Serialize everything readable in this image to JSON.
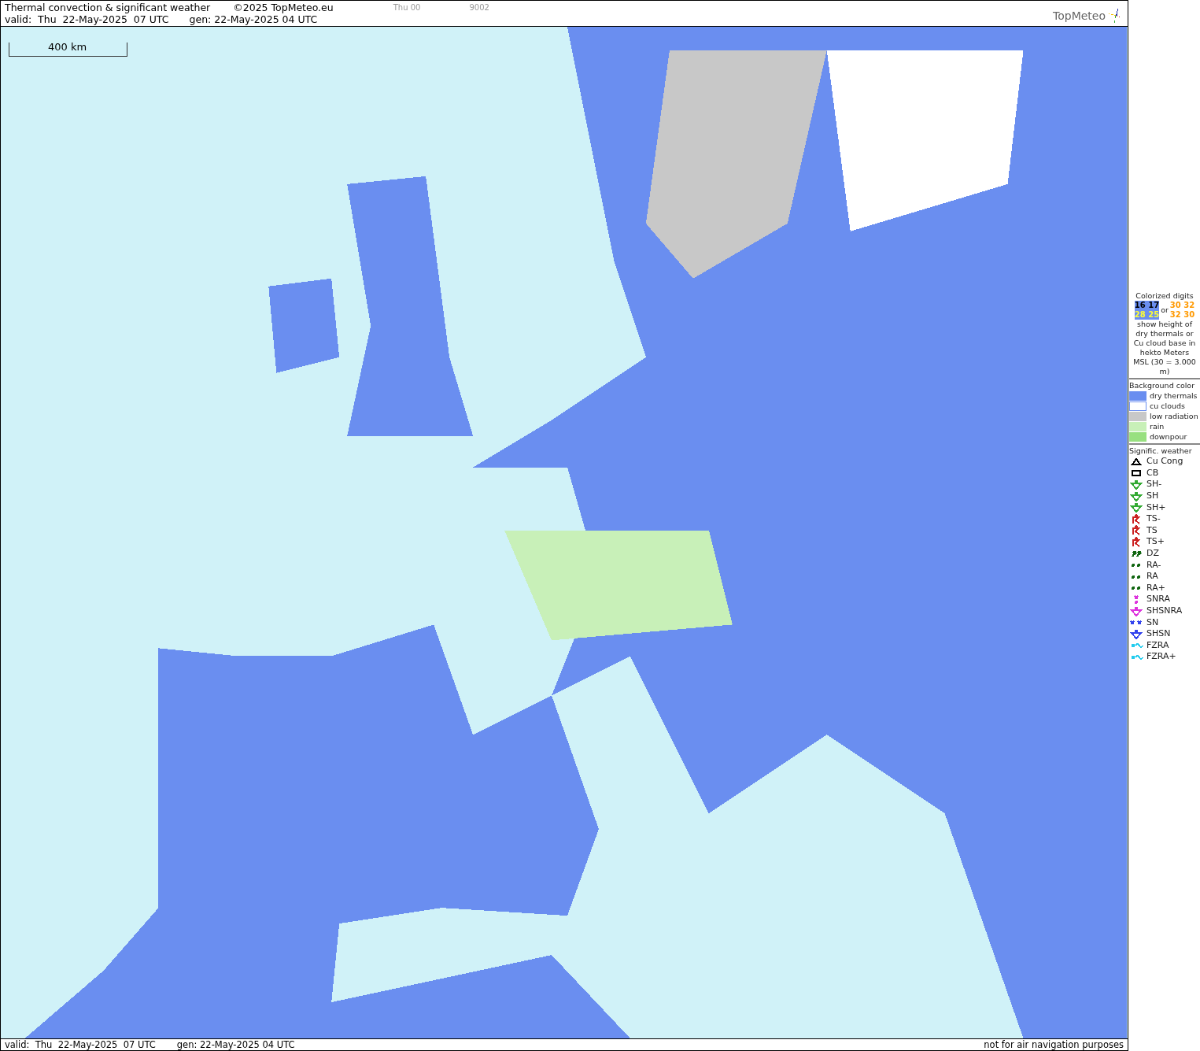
{
  "header": {
    "title": "Thermal convection & significant weather",
    "copyright": "©2025 TopMeteo.eu",
    "run": "Thu 00",
    "code": "9002",
    "valid": "valid:  Thu  22-May-2025  07 UTC",
    "gen": "gen: 22-May-2025 04 UTC",
    "logo": "TopMeteo"
  },
  "map": {
    "scale": "400 km"
  },
  "legend": {
    "digits_title": "Colorized digits",
    "samples": [
      {
        "text": "16 17",
        "kind": "dark"
      },
      {
        "text": "30 32",
        "kind": "orange"
      },
      {
        "text": "28 25",
        "kind": "light"
      },
      {
        "text": "32 30",
        "kind": "orange"
      }
    ],
    "or": "or",
    "explanation": "show height of dry thermals or Cu cloud base in hekto Meters MSL (30 = 3.000 m)",
    "background_title": "Background color",
    "backgrounds": [
      {
        "label": "dry thermals",
        "color": "#6a8ef0"
      },
      {
        "label": "cu clouds",
        "color": "#ffffff"
      },
      {
        "label": "low radiation",
        "color": "#c8c8c8"
      },
      {
        "label": "rain",
        "color": "#c8f0b8"
      },
      {
        "label": "downpour",
        "color": "#98e080"
      }
    ],
    "weather_title": "Signific. weather",
    "weather": [
      {
        "label": "Cu Cong",
        "kind": "cucong",
        "color": "#000000"
      },
      {
        "label": "CB",
        "kind": "cb",
        "color": "#000000"
      },
      {
        "label": "SH-",
        "kind": "shower",
        "color": "#33aa33"
      },
      {
        "label": "SH",
        "kind": "shower",
        "color": "#33aa33"
      },
      {
        "label": "SH+",
        "kind": "shower",
        "color": "#33aa33"
      },
      {
        "label": "TS-",
        "kind": "storm",
        "color": "#cc2222"
      },
      {
        "label": "TS",
        "kind": "storm",
        "color": "#cc2222"
      },
      {
        "label": "TS+",
        "kind": "storm",
        "color": "#cc2222"
      },
      {
        "label": "DZ",
        "kind": "drizzle",
        "color": "#116611"
      },
      {
        "label": "RA-",
        "kind": "rain",
        "color": "#116611"
      },
      {
        "label": "RA",
        "kind": "rain",
        "color": "#116611"
      },
      {
        "label": "RA+",
        "kind": "rain",
        "color": "#116611"
      },
      {
        "label": "SNRA",
        "kind": "snowrain",
        "color": "#dd33dd"
      },
      {
        "label": "SHSNRA",
        "kind": "shower",
        "color": "#dd33dd"
      },
      {
        "label": "SN",
        "kind": "snow",
        "color": "#3344ee"
      },
      {
        "label": "SHSN",
        "kind": "shower",
        "color": "#3344ee"
      },
      {
        "label": "FZRA",
        "kind": "freezing",
        "color": "#22ccee"
      },
      {
        "label": "FZRA+",
        "kind": "freezing",
        "color": "#22ccee"
      }
    ]
  },
  "footer": {
    "valid": "valid:  Thu  22-May-2025  07 UTC",
    "gen": "gen: 22-May-2025 04 UTC",
    "note": "not for air navigation purposes"
  }
}
